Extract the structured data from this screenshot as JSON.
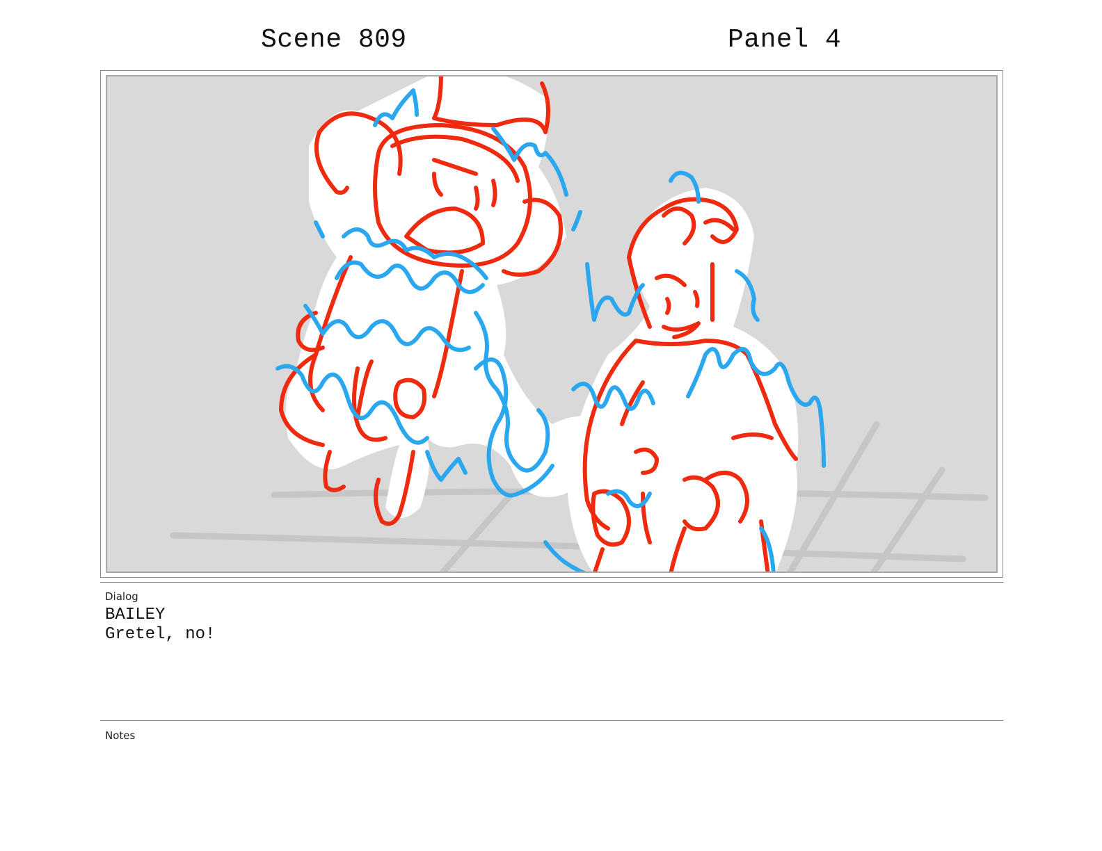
{
  "header": {
    "scene": "Scene 809",
    "panel": "Panel 4"
  },
  "dialog": {
    "label": "Dialog",
    "speaker": "BAILEY",
    "line": "Gretel, no!"
  },
  "notes": {
    "label": "Notes"
  },
  "colors": {
    "background": "#d9d9d9",
    "rough_sketch": "#ee2a0f",
    "effect_lines": "#2aa7ee",
    "floor_lines": "#c4c4c4"
  }
}
